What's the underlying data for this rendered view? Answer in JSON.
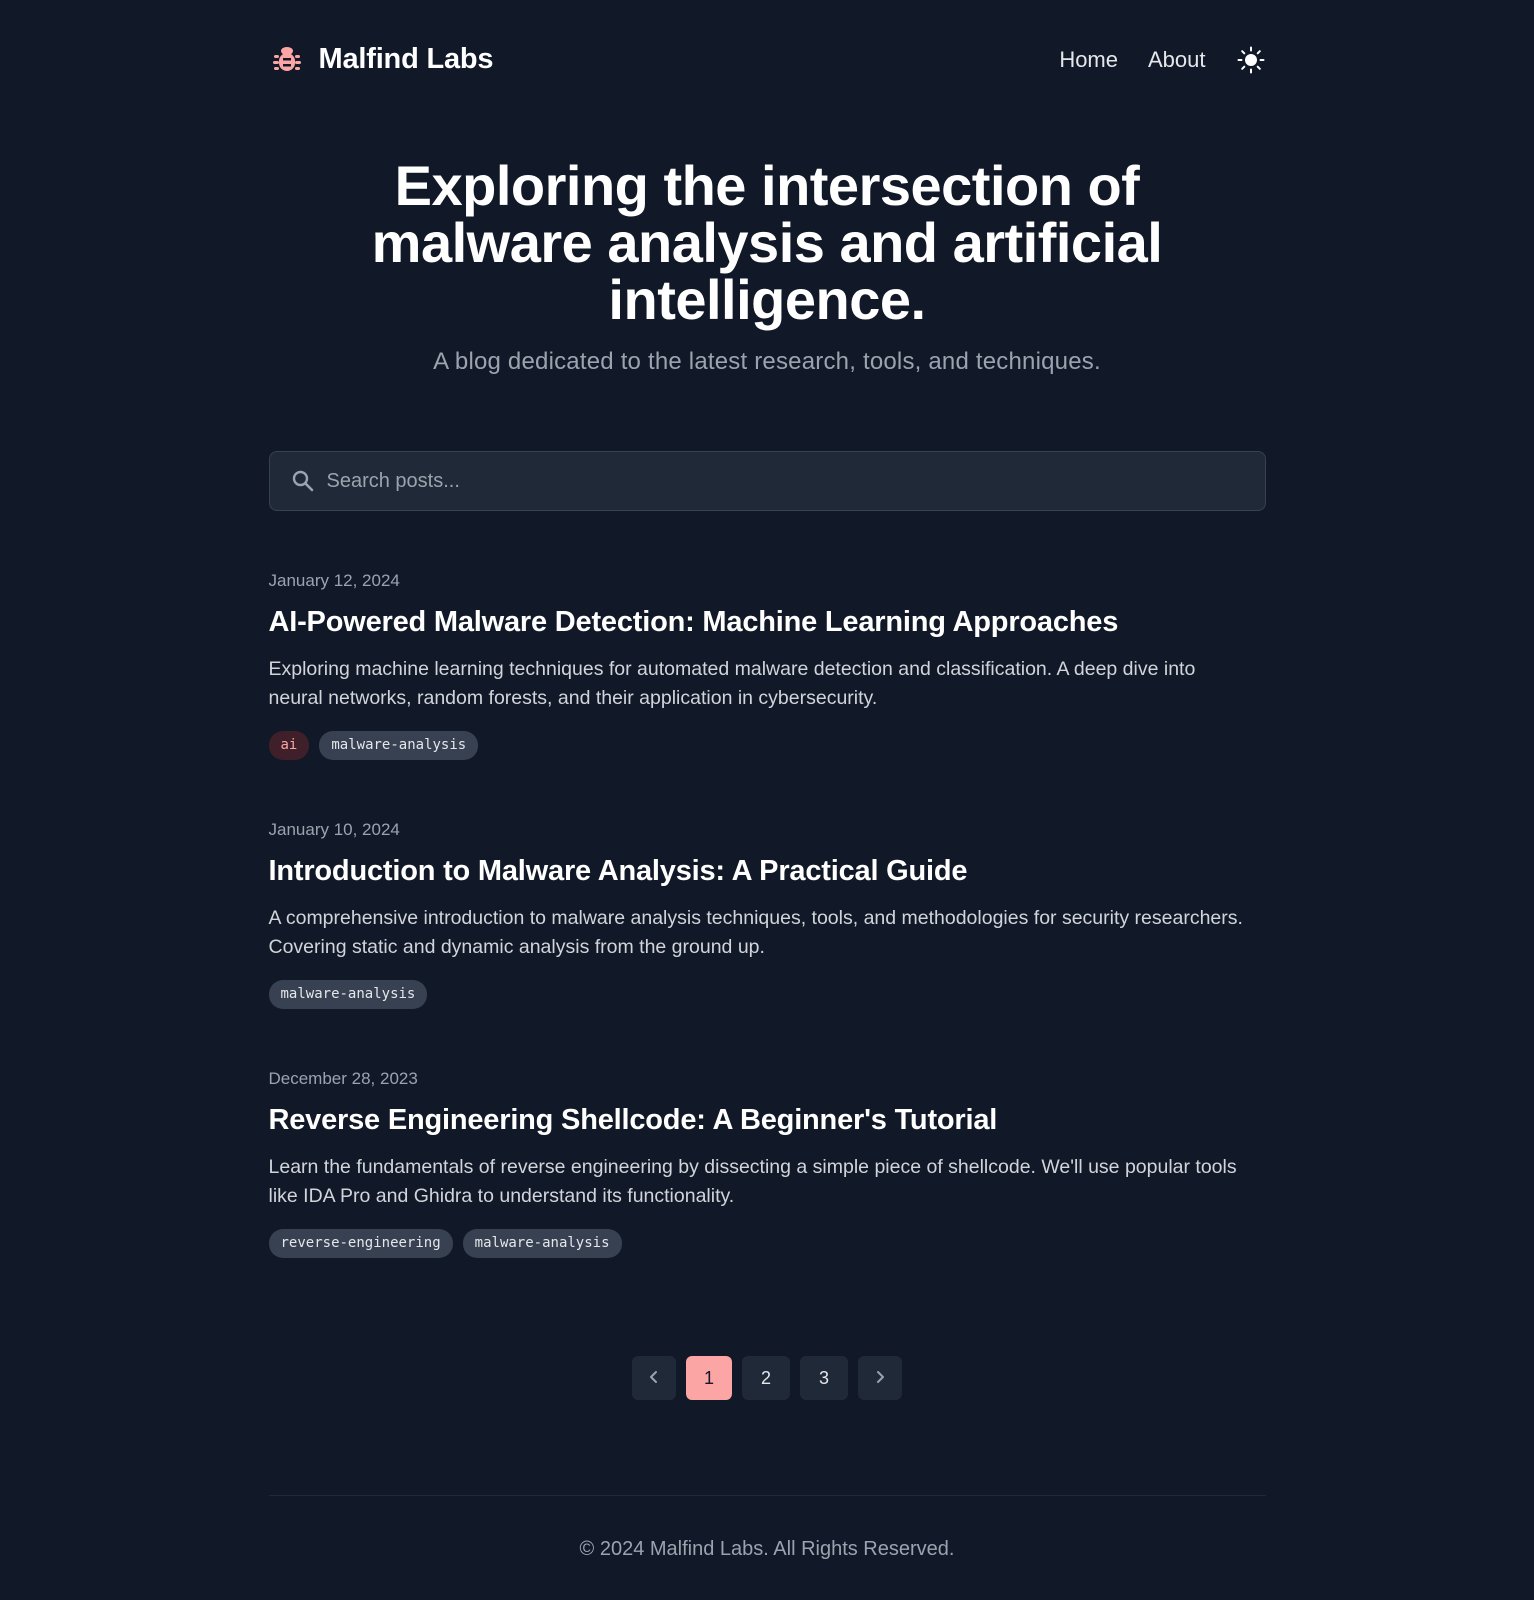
{
  "brand": {
    "name": "Malfind Labs",
    "icon": "bug-icon",
    "icon_color": "#fca5a5"
  },
  "nav": {
    "home": "Home",
    "about": "About",
    "theme_icon": "sun-icon"
  },
  "hero": {
    "title": "Exploring the intersection of malware analysis and artificial intelligence.",
    "subtitle": "A blog dedicated to the latest research, tools, and techniques."
  },
  "search": {
    "placeholder": "Search posts...",
    "value": "",
    "icon": "search-icon"
  },
  "posts": [
    {
      "date": "January 12, 2024",
      "title": "AI-Powered Malware Detection: Machine Learning Approaches",
      "excerpt": "Exploring machine learning techniques for automated malware detection and classification. A deep dive into neural networks, random forests, and their application in cybersecurity.",
      "tags": [
        "ai",
        "malware-analysis"
      ]
    },
    {
      "date": "January 10, 2024",
      "title": "Introduction to Malware Analysis: A Practical Guide",
      "excerpt": "A comprehensive introduction to malware analysis techniques, tools, and methodologies for security researchers. Covering static and dynamic analysis from the ground up.",
      "tags": [
        "malware-analysis"
      ]
    },
    {
      "date": "December 28, 2023",
      "title": "Reverse Engineering Shellcode: A Beginner's Tutorial",
      "excerpt": "Learn the fundamentals of reverse engineering by dissecting a simple piece of shellcode. We'll use popular tools like IDA Pro and Ghidra to understand its functionality.",
      "tags": [
        "reverse-engineering",
        "malware-analysis"
      ]
    }
  ],
  "pagination": {
    "pages": [
      "1",
      "2",
      "3"
    ],
    "current": "1",
    "prev_icon": "chevron-left-icon",
    "next_icon": "chevron-right-icon"
  },
  "footer": {
    "copyright": "© 2024 Malfind Labs. All Rights Reserved."
  },
  "colors": {
    "background": "#111827",
    "surface": "#1f2937",
    "accent": "#fca5a5",
    "muted": "#9ca3af"
  }
}
